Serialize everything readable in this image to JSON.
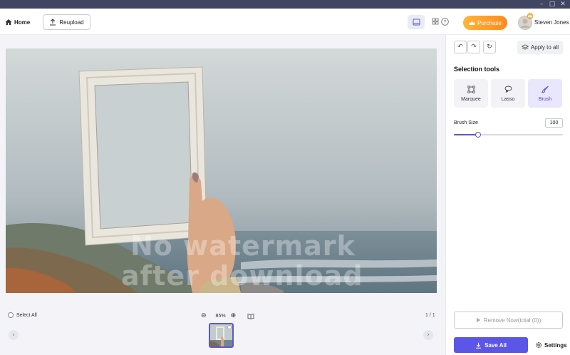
{
  "window": {
    "minimize_glyph": "–",
    "maximize_glyph": "□",
    "close_glyph": "✕"
  },
  "toolbar": {
    "home_label": "Home",
    "reupload_label": "Reupload",
    "purchase_label": "Purchase",
    "user_name": "Steven Jones",
    "help_glyph": "?"
  },
  "canvas": {
    "watermark_line1": "No watermark",
    "watermark_line2": "after download",
    "select_all_label": "Select All",
    "zoom_level": "85%",
    "zoom_out_glyph": "⊖",
    "zoom_in_glyph": "⊕",
    "page_indicator": "1 / 1",
    "prev_glyph": "‹",
    "next_glyph": "›"
  },
  "panel": {
    "undo_glyph": "↶",
    "redo_glyph": "↷",
    "reset_glyph": "↻",
    "apply_to_all_label": "Apply to all",
    "section_title": "Selection tools",
    "tools": [
      {
        "label": "Marquee",
        "icon": "marquee-icon",
        "active": false
      },
      {
        "label": "Lasso",
        "icon": "lasso-icon",
        "active": false
      },
      {
        "label": "Brush",
        "icon": "brush-icon",
        "active": true
      }
    ],
    "brush_size_label": "Brush Size",
    "brush_size_value": "100",
    "brush_slider_fraction": 0.22,
    "remove_now_label": "Remove Now(total (0))",
    "save_all_label": "Save All",
    "settings_label": "Settings"
  },
  "colors": {
    "accent": "#5b56e6",
    "titlebar": "#404562",
    "purchase_start": "#ffb53b",
    "purchase_end": "#ff8a1f"
  }
}
